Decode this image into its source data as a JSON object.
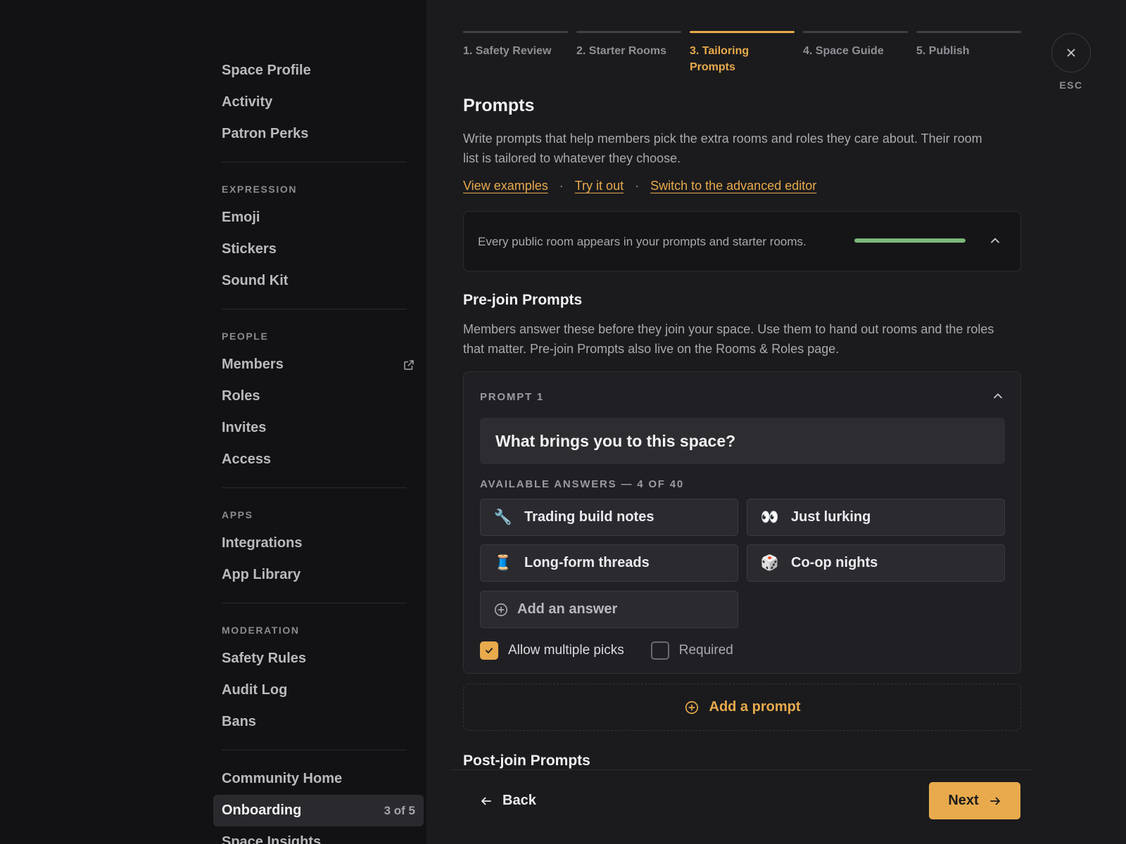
{
  "sidebar": {
    "top_items": [
      "Space Profile",
      "Activity",
      "Patron Perks"
    ],
    "expression": {
      "label": "EXPRESSION",
      "items": [
        "Emoji",
        "Stickers",
        "Sound Kit"
      ]
    },
    "people": {
      "label": "PEOPLE",
      "items": [
        "Members",
        "Roles",
        "Invites",
        "Access"
      ]
    },
    "apps": {
      "label": "APPS",
      "items": [
        "Integrations",
        "App Library"
      ]
    },
    "moderation": {
      "label": "MODERATION",
      "items": [
        "Safety Rules",
        "Audit Log",
        "Bans"
      ]
    },
    "bottom": {
      "community_home": "Community Home",
      "onboarding": "Onboarding",
      "onboarding_count": "3 of 5",
      "space_insights": "Space Insights"
    }
  },
  "steps": [
    "1. Safety Review",
    "2. Starter Rooms",
    "3. Tailoring Prompts",
    "4. Space Guide",
    "5. Publish"
  ],
  "active_step": 3,
  "close": {
    "esc_label": "ESC"
  },
  "prompts": {
    "title": "Prompts",
    "description": "Write prompts that help members pick the extra rooms and roles they care about. Their room list is tailored to whatever they choose.",
    "links": [
      "View examples",
      "Try it out",
      "Switch to the advanced editor"
    ],
    "coverage_text": "Every public room appears in your prompts and starter rooms.",
    "coverage_progress": 1.0
  },
  "prejoin": {
    "title": "Pre-join Prompts",
    "description": "Members answer these before they join your space. Use them to hand out rooms and the roles that matter. Pre-join Prompts also live on the Rooms & Roles page.",
    "prompt": {
      "label": "PROMPT 1",
      "question": "What brings you to this space?",
      "answers_label": "AVAILABLE ANSWERS — 4 OF 40",
      "answers": [
        {
          "emoji": "🔧",
          "label": "Trading build notes"
        },
        {
          "emoji": "👀",
          "label": "Just lurking"
        },
        {
          "emoji": "🧵",
          "label": "Long-form threads"
        },
        {
          "emoji": "🎲",
          "label": "Co-op nights"
        }
      ],
      "add_answer": "Add an answer",
      "allow_multiple": {
        "label": "Allow multiple picks",
        "checked": true
      },
      "required": {
        "label": "Required",
        "checked": false
      }
    },
    "add_prompt": "Add a prompt"
  },
  "postjoin": {
    "title": "Post-join Prompts"
  },
  "footer": {
    "back": "Back",
    "next": "Next"
  },
  "colors": {
    "accent": "#e8aa4c",
    "success": "#7bb87a",
    "background": "#1b1b1e",
    "sidebar": "#121214"
  }
}
